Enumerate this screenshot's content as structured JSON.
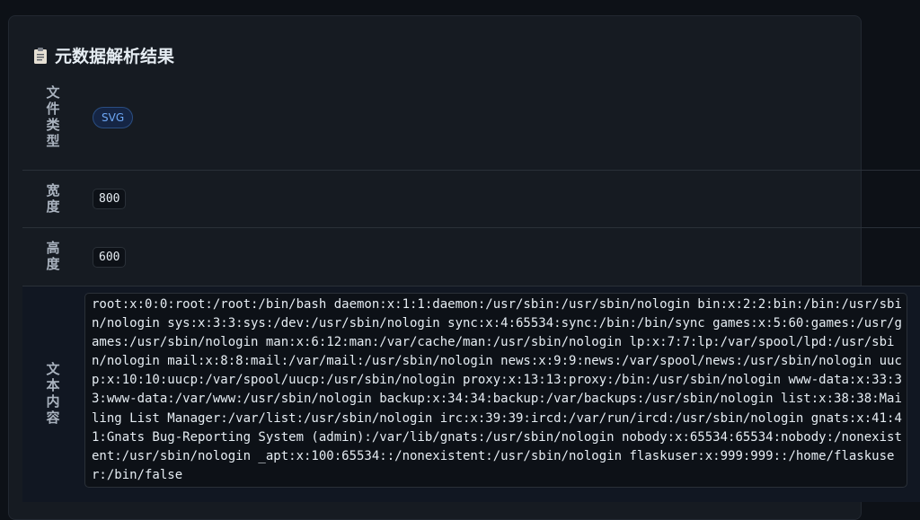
{
  "panel": {
    "title": "元数据解析结果",
    "title_icon": "clipboard-icon"
  },
  "rows": {
    "file_type": {
      "label": "文件类型",
      "value": "SVG"
    },
    "width": {
      "label": "宽度",
      "value": "800"
    },
    "height": {
      "label": "高度",
      "value": "600"
    },
    "text_content": {
      "label": "文本内容",
      "value": " root:x:0:0:root:/root:/bin/bash daemon:x:1:1:daemon:/usr/sbin:/usr/sbin/nologin bin:x:2:2:bin:/bin:/usr/sbin/nologin sys:x:3:3:sys:/dev:/usr/sbin/nologin sync:x:4:65534:sync:/bin:/bin/sync games:x:5:60:games:/usr/games:/usr/sbin/nologin man:x:6:12:man:/var/cache/man:/usr/sbin/nologin lp:x:7:7:lp:/var/spool/lpd:/usr/sbin/nologin mail:x:8:8:mail:/var/mail:/usr/sbin/nologin news:x:9:9:news:/var/spool/news:/usr/sbin/nologin uucp:x:10:10:uucp:/var/spool/uucp:/usr/sbin/nologin proxy:x:13:13:proxy:/bin:/usr/sbin/nologin www-data:x:33:33:www-data:/var/www:/usr/sbin/nologin backup:x:34:34:backup:/var/backups:/usr/sbin/nologin list:x:38:38:Mailing List Manager:/var/list:/usr/sbin/nologin irc:x:39:39:ircd:/var/run/ircd:/usr/sbin/nologin gnats:x:41:41:Gnats Bug-Reporting System (admin):/var/lib/gnats:/usr/sbin/nologin nobody:x:65534:65534:nobody:/nonexistent:/usr/sbin/nologin _apt:x:100:65534::/nonexistent:/usr/sbin/nologin flaskuser:x:999:999::/home/flaskuser:/bin/false"
    }
  },
  "colors": {
    "page_bg": "#0d1117",
    "card_bg": "#161b22",
    "badge_text": "#6ea8f5",
    "badge_bg": "#152544"
  }
}
